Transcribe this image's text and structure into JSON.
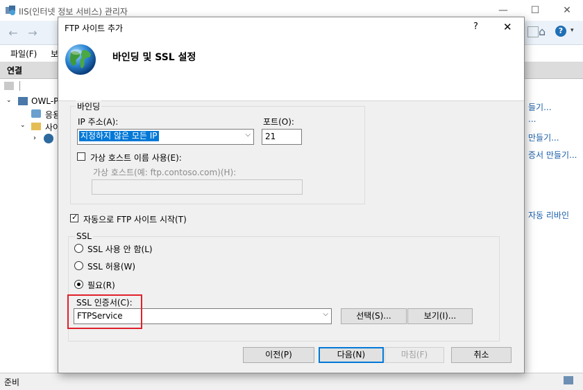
{
  "background": {
    "window_title": "IIS(인터넷 정보 서비스) 관리자",
    "menu": [
      "파일(F)",
      "보"
    ],
    "left_pane_header": "연결",
    "tree": {
      "server": "OWL-P",
      "app_pools": "응용",
      "sites": "사이"
    },
    "right_links": [
      "들기...",
      "...",
      "만들기...",
      "증서 만들기...",
      "자동 리바인"
    ],
    "status": "준비"
  },
  "dialog": {
    "title": "FTP 사이트 추가",
    "help": "?",
    "close": "✕",
    "header": "바인딩 및 SSL 설정",
    "binding": {
      "legend": "바인딩",
      "ip_label": "IP 주소(A):",
      "ip_value": "지정하지 않은 모든 IP",
      "port_label": "포트(O):",
      "port_value": "21",
      "virtual_host_checkbox": "가상 호스트 이름 사용(E):",
      "virtual_host_checked": false,
      "virtual_host_label": "가상 호스트(예: ftp.contoso.com)(H):",
      "virtual_host_value": ""
    },
    "auto_start": {
      "label": "자동으로 FTP 사이트 시작(T)",
      "checked": true
    },
    "ssl": {
      "legend": "SSL",
      "options": [
        "SSL 사용 안 함(L)",
        "SSL 허용(W)",
        "필요(R)"
      ],
      "selected": "필요(R)",
      "cert_label": "SSL 인증서(C):",
      "cert_value": "FTPService",
      "select_button": "선택(S)...",
      "view_button": "보기(I)..."
    },
    "buttons": {
      "prev": "이전(P)",
      "next": "다음(N)",
      "finish": "마침(F)",
      "cancel": "취소"
    }
  },
  "colors": {
    "accent": "#0078d7",
    "highlight_box": "#e0202a",
    "link": "#1a5ea8"
  }
}
